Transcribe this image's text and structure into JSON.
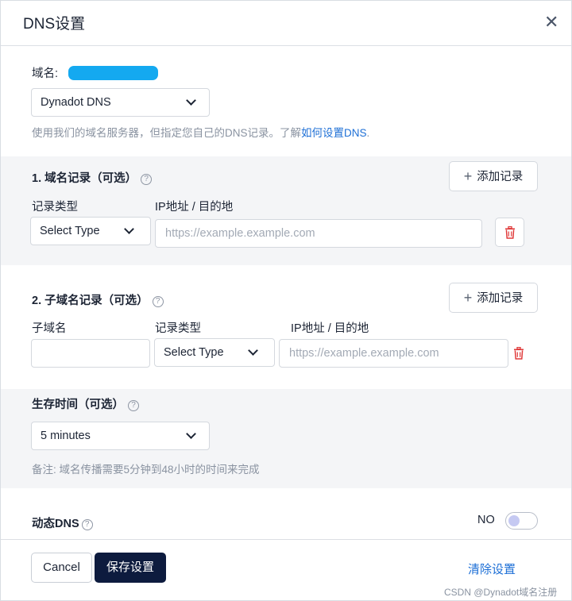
{
  "dialog": {
    "title": "DNS设置",
    "close_glyph": "✕"
  },
  "domain": {
    "label": "域名:",
    "dns_select_value": "Dynadot DNS",
    "description_prefix": "使用我们的域名服务器，但指定您自己的DNS记录。了解",
    "description_link": "如何设置DNS",
    "description_suffix": "."
  },
  "section1": {
    "title": "1. 域名记录（可选）",
    "add_button": "添加记录",
    "col_type": "记录类型",
    "col_ip": "IP地址 / 目的地",
    "type_select_value": "Select Type",
    "ip_placeholder": "https://example.example.com"
  },
  "section2": {
    "title": "2. 子域名记录（可选）",
    "add_button": "添加记录",
    "col_subdomain": "子域名",
    "col_type": "记录类型",
    "col_ip": "IP地址 / 目的地",
    "subdomain_value": "",
    "type_select_value": "Select Type",
    "ip_placeholder": "https://example.example.com"
  },
  "ttl": {
    "title": "生存时间（可选）",
    "select_value": "5 minutes",
    "note": "备注: 域名传播需要5分钟到48小时的时间来完成"
  },
  "dynamic_dns": {
    "label": "动态DNS",
    "toggle_state": "NO"
  },
  "footer": {
    "cancel_label": "Cancel",
    "save_label": "保存设置",
    "clear_label": "清除设置"
  },
  "watermark": "CSDN @Dynadot域名注册",
  "help_glyph": "?",
  "plus_glyph": "+",
  "icons": {
    "close": "close-icon",
    "chevron": "chevron-down-icon",
    "help": "help-circle-icon",
    "plus": "plus-icon",
    "trash": "trash-icon"
  },
  "colors": {
    "primary_button": "#0d1b3e",
    "link": "#1d6fd6",
    "delete_icon": "#e03a3a",
    "section_background": "#f4f5f7",
    "domain_redaction": "#14a9f0",
    "toggle_knob": "#c5c9f2"
  }
}
